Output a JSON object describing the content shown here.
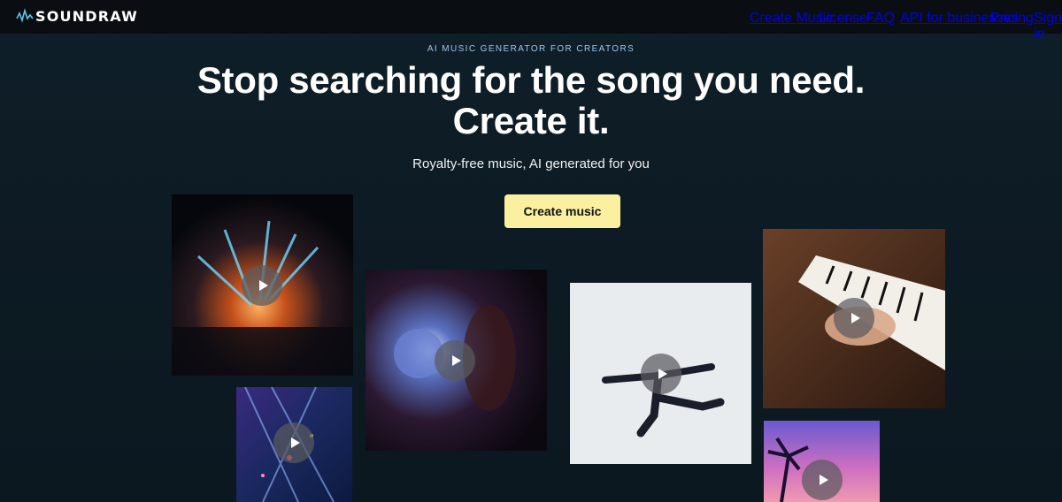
{
  "brand": {
    "name": "SOUNDRAW",
    "logo_icon": "soundwave-logo-icon"
  },
  "nav": {
    "items": [
      {
        "label": "Create Music"
      },
      {
        "label": "License"
      },
      {
        "label": "FAQ"
      },
      {
        "label": "API for businesses"
      },
      {
        "label": "Pricing"
      },
      {
        "label": "Sign in"
      }
    ]
  },
  "hero": {
    "eyebrow": "AI MUSIC GENERATOR FOR CREATORS",
    "headline_line1": "Stop searching for the song you need.",
    "headline_line2": "Create it.",
    "subhead": "Royalty-free music, AI generated for you",
    "cta_label": "Create music",
    "cta_color": "#faf0a0"
  },
  "videos": [
    {
      "name": "concert-video",
      "icon": "play-icon"
    },
    {
      "name": "city-night-video",
      "icon": "play-icon"
    },
    {
      "name": "disco-ball-video",
      "icon": "play-icon"
    },
    {
      "name": "dancer-video",
      "icon": "play-icon"
    },
    {
      "name": "piano-video",
      "icon": "play-icon"
    },
    {
      "name": "palm-sunset-video",
      "icon": "play-icon"
    }
  ]
}
